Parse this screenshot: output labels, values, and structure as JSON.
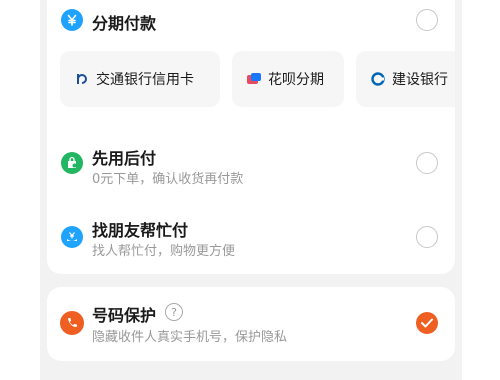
{
  "installment": {
    "title": "分期付款",
    "icon": "yen-icon",
    "banks": [
      {
        "name": "交通银行信用卡",
        "icon": "bocom-icon"
      },
      {
        "name": "花呗分期",
        "icon": "huabei-icon"
      },
      {
        "name": "建设银行",
        "icon": "ccb-icon"
      }
    ]
  },
  "pay_later": {
    "title": "先用后付",
    "subtitle": "0元下单，确认收货再付款",
    "icon": "pay-later-icon"
  },
  "friend_pay": {
    "title": "找朋友帮忙付",
    "subtitle": "找人帮忙付，购物更方便",
    "icon": "friend-pay-icon"
  },
  "privacy": {
    "title": "号码保护",
    "subtitle": "隐藏收件人真实手机号，保护隐私",
    "help_icon": "question-circle-icon",
    "icon": "phone-shield-icon",
    "checked": true
  },
  "colors": {
    "accent": "#f05f22",
    "blue": "#1fa3ff",
    "green": "#22b562",
    "text": "#1a1a1a",
    "subtext": "#999999"
  }
}
